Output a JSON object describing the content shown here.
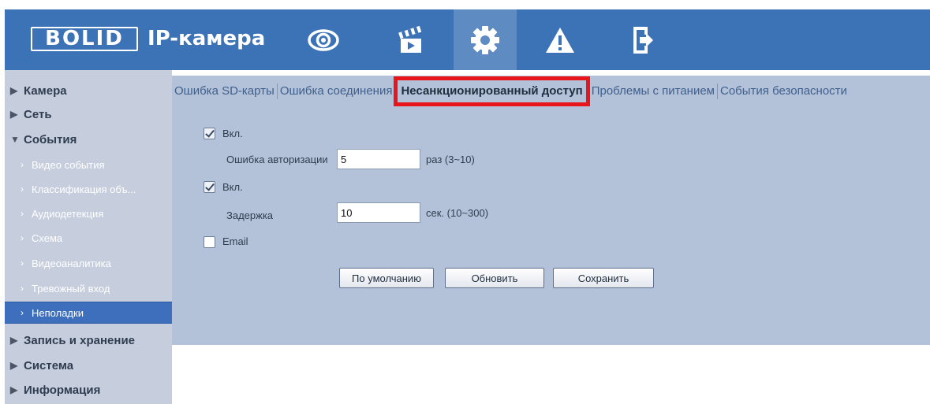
{
  "header": {
    "logo_text": "BOLID",
    "title": "IP-камера",
    "nav": [
      {
        "name": "live-view",
        "icon": "eye-icon"
      },
      {
        "name": "playback",
        "icon": "clapperboard-icon"
      },
      {
        "name": "setup",
        "icon": "gear-icon",
        "active": true
      },
      {
        "name": "alarm",
        "icon": "warning-icon"
      },
      {
        "name": "logout",
        "icon": "logout-icon"
      }
    ]
  },
  "sidebar": {
    "items": [
      {
        "label": "Камера",
        "type": "top",
        "expanded": false
      },
      {
        "label": "Сеть",
        "type": "top",
        "expanded": false
      },
      {
        "label": "События",
        "type": "top",
        "expanded": true
      },
      {
        "label": "Видео события",
        "type": "sub"
      },
      {
        "label": "Классификация объ...",
        "type": "sub"
      },
      {
        "label": "Аудиодетекция",
        "type": "sub"
      },
      {
        "label": "Схема",
        "type": "sub"
      },
      {
        "label": "Видеоаналитика",
        "type": "sub"
      },
      {
        "label": "Тревожный вход",
        "type": "sub"
      },
      {
        "label": "Неполадки",
        "type": "sub",
        "active": true
      },
      {
        "label": "Запись и хранение",
        "type": "top",
        "expanded": false
      },
      {
        "label": "Система",
        "type": "top",
        "expanded": false
      },
      {
        "label": "Информация",
        "type": "top",
        "expanded": false
      }
    ]
  },
  "tabs": [
    {
      "label": "Ошибка SD-карты"
    },
    {
      "label": "Ошибка соединения"
    },
    {
      "label": "Несанкционированный доступ",
      "active": true
    },
    {
      "label": "Проблемы с питанием"
    },
    {
      "label": "События безопасности"
    }
  ],
  "form": {
    "enable1_label": "Вкл.",
    "enable1_checked": true,
    "auth_error_label": "Ошибка авторизации",
    "auth_error_value": "5",
    "auth_error_unit": "раз (3~10)",
    "enable2_label": "Вкл.",
    "enable2_checked": true,
    "delay_label": "Задержка",
    "delay_value": "10",
    "delay_unit": "сек. (10~300)",
    "email_label": "Email",
    "email_checked": false
  },
  "buttons": {
    "default_label": "По умолчанию",
    "refresh_label": "Обновить",
    "save_label": "Сохранить"
  },
  "colors": {
    "header_bg": "#3c72b6",
    "sidebar_bg": "#c6cede",
    "content_bg": "#b3c2d8",
    "active_item_bg": "#3d6fbd",
    "highlight": "#e8151b"
  }
}
